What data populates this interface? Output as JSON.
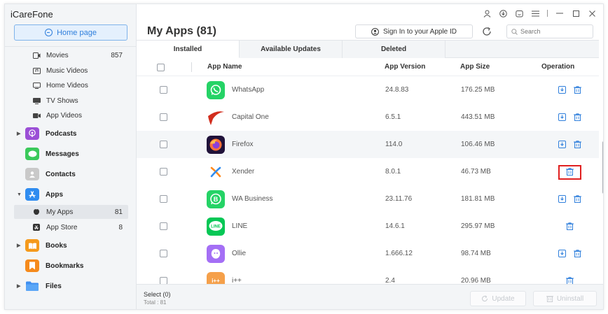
{
  "app": {
    "title": "iCareFone",
    "home_label": "Home page"
  },
  "sidebar": {
    "sub_items": [
      {
        "label": "Movies",
        "count": "857",
        "icon": "movie-icon"
      },
      {
        "label": "Music Videos",
        "count": "",
        "icon": "music-video-icon"
      },
      {
        "label": "Home Videos",
        "count": "",
        "icon": "home-video-icon"
      },
      {
        "label": "TV Shows",
        "count": "",
        "icon": "tv-icon"
      },
      {
        "label": "App Videos",
        "count": "",
        "icon": "app-video-icon"
      }
    ],
    "categories": [
      {
        "label": "Podcasts",
        "icon": "podcasts-icon",
        "color": "#9b4fd6"
      },
      {
        "label": "Messages",
        "icon": "messages-icon",
        "color": "#3ac95a"
      },
      {
        "label": "Contacts",
        "icon": "contacts-icon",
        "color": "#b9b9b9"
      },
      {
        "label": "Apps",
        "icon": "app-store-icon",
        "color": "#2f8cf0"
      },
      {
        "label": "Books",
        "icon": "books-icon",
        "color": "#f59a1c"
      },
      {
        "label": "Bookmarks",
        "icon": "bookmarks-icon",
        "color": "#f58a1c"
      },
      {
        "label": "Files",
        "icon": "files-icon",
        "color": "#3f8ff0"
      }
    ],
    "apps_children": [
      {
        "label": "My Apps",
        "count": "81"
      },
      {
        "label": "App Store",
        "count": "8"
      }
    ]
  },
  "header": {
    "title": "My Apps (81)",
    "signin_label": "Sign In to your Apple ID",
    "search_placeholder": "Search"
  },
  "tabs": [
    "Installed",
    "Available Updates",
    "Deleted"
  ],
  "table": {
    "columns": [
      "App Name",
      "App Version",
      "App Size",
      "Operation"
    ],
    "rows": [
      {
        "name": "WhatsApp",
        "version": "24.8.83",
        "size": "176.25 MB",
        "icon": "whatsapp-icon",
        "color": "#25d366",
        "glyph": "",
        "update": true
      },
      {
        "name": "Capital One",
        "version": "6.5.1",
        "size": "443.51 MB",
        "icon": "capital-one-icon",
        "color": "#ffffff",
        "glyph": "",
        "update": true
      },
      {
        "name": "Firefox",
        "version": "114.0",
        "size": "106.46 MB",
        "icon": "firefox-icon",
        "color": "#20123a",
        "glyph": "",
        "update": true
      },
      {
        "name": "Xender",
        "version": "8.0.1",
        "size": "46.73 MB",
        "icon": "xender-icon",
        "color": "#ffffff",
        "glyph": "",
        "update": false
      },
      {
        "name": "WA Business",
        "version": "23.11.76",
        "size": "181.81 MB",
        "icon": "wa-business-icon",
        "color": "#25d366",
        "glyph": "B",
        "update": true
      },
      {
        "name": "LINE",
        "version": "14.6.1",
        "size": "295.97 MB",
        "icon": "line-icon",
        "color": "#06c755",
        "glyph": "LINE",
        "update": false
      },
      {
        "name": "Ollie",
        "version": "1.666.12",
        "size": "98.74 MB",
        "icon": "ollie-icon",
        "color": "#a46ff5",
        "glyph": "",
        "update": true
      },
      {
        "name": "i++",
        "version": "2.4",
        "size": "20.96 MB",
        "icon": "ipp-icon",
        "color": "#f5a04a",
        "glyph": "i++",
        "update": false
      }
    ]
  },
  "footer": {
    "select_label": "Select (0)",
    "total_label": "Total : 81",
    "update_label": "Update",
    "uninstall_label": "Uninstall"
  },
  "colors": {
    "accent": "#2f7fdc",
    "highlight_border": "#e02020"
  }
}
